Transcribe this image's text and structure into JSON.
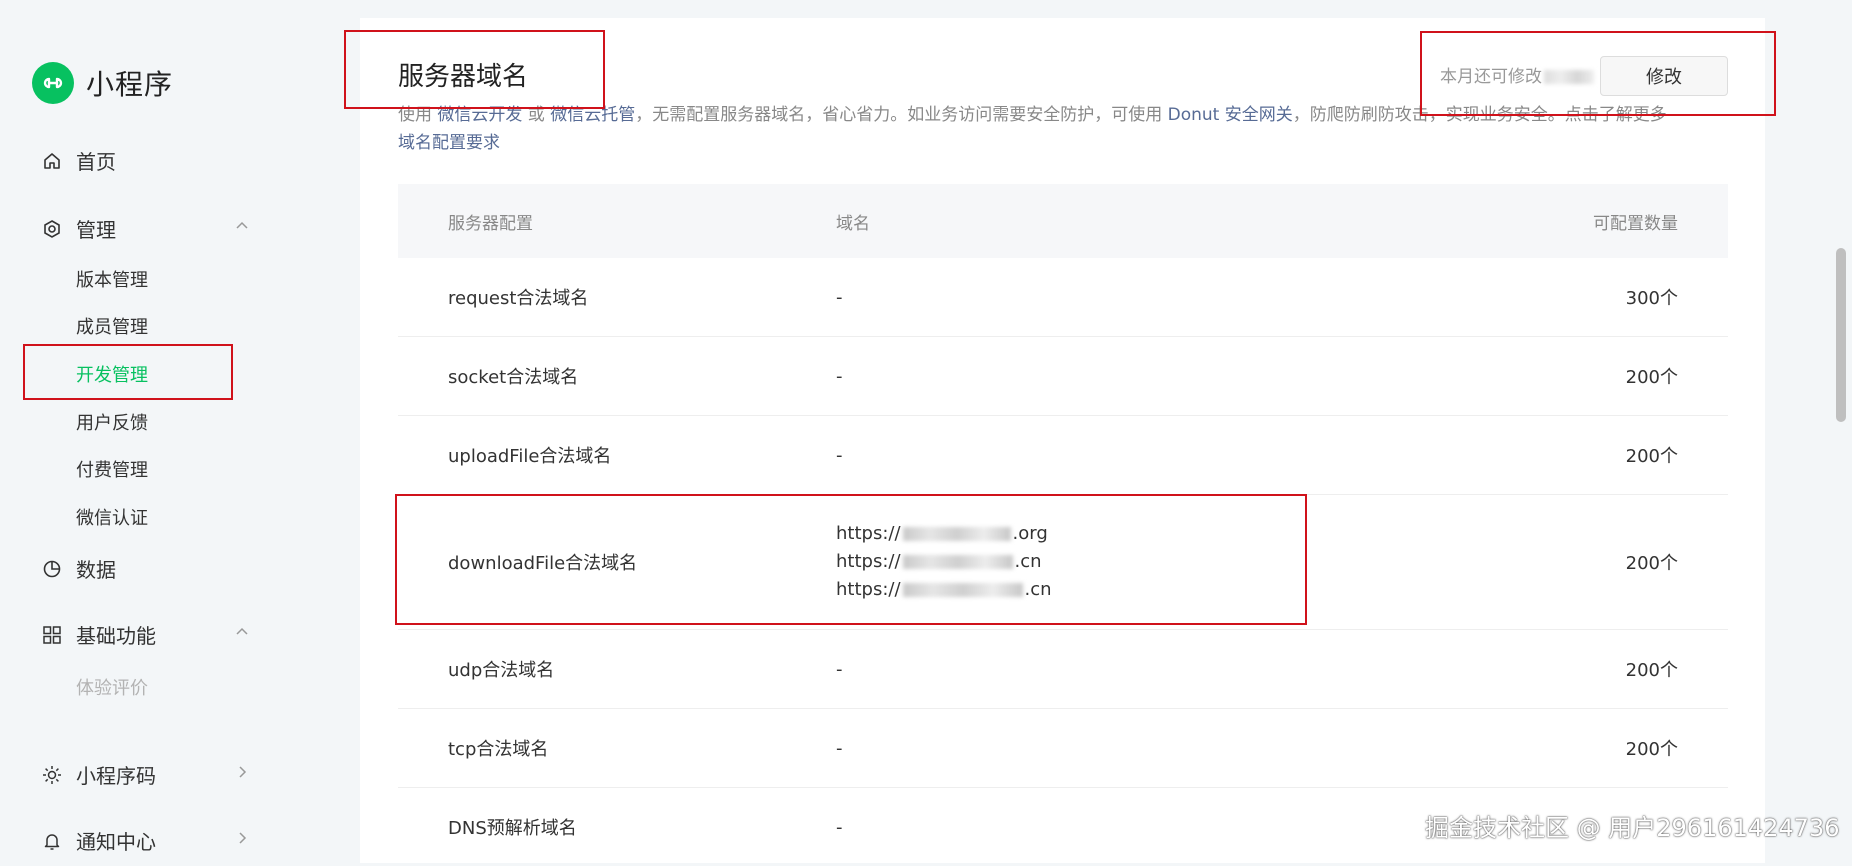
{
  "app": {
    "title": "小程序"
  },
  "sidebar": {
    "home": "首页",
    "manage": {
      "label": "管理",
      "items": [
        "版本管理",
        "成员管理",
        "开发管理",
        "用户反馈",
        "付费管理",
        "微信认证"
      ]
    },
    "data": "数据",
    "basic": {
      "label": "基础功能",
      "items": [
        "体验评价"
      ]
    },
    "qrcode": "小程序码",
    "notify": "通知中心"
  },
  "main": {
    "title": "服务器域名",
    "quota_text": "本月还可修改",
    "edit_button": "修改",
    "desc": {
      "p1": "使用 ",
      "link1": "微信云开发",
      "p2": " 或 ",
      "link2": "微信云托管",
      "p3": "，无需配置服务器域名，省心省力。如业务访问需要安全防护，可使用 ",
      "link3": "Donut 安全网关",
      "p4": "，防爬防刷防攻击，实现业务安全。点击了解更多",
      "link4": "域名配置要求"
    },
    "table": {
      "headers": [
        "服务器配置",
        "域名",
        "可配置数量"
      ],
      "rows": [
        {
          "name": "request合法域名",
          "domain": "-",
          "count": "300个"
        },
        {
          "name": "socket合法域名",
          "domain": "-",
          "count": "200个"
        },
        {
          "name": "uploadFile合法域名",
          "domain": "-",
          "count": "200个"
        },
        {
          "name": "downloadFile合法域名",
          "domains": [
            {
              "prefix": "https://",
              "suffix": ".org"
            },
            {
              "prefix": "https://",
              "suffix": ".cn"
            },
            {
              "prefix": "https://",
              "suffix": ".cn"
            }
          ],
          "count": "200个"
        },
        {
          "name": "udp合法域名",
          "domain": "-",
          "count": "200个"
        },
        {
          "name": "tcp合法域名",
          "domain": "-",
          "count": "200个"
        },
        {
          "name": "DNS预解析域名",
          "domain": "-",
          "count": ""
        }
      ]
    }
  },
  "watermark": "掘金技术社区 @ 用户296161424736",
  "colors": {
    "accent": "#07c160",
    "link": "#576b95",
    "highlight": "#d0121b"
  }
}
